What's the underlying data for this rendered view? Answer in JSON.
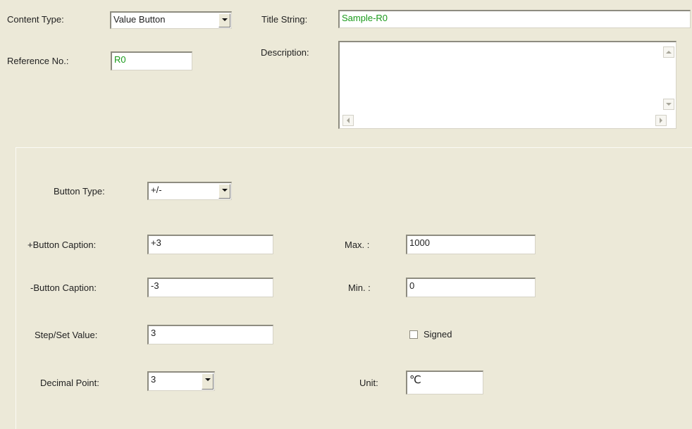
{
  "top": {
    "content_type_label": "Content Type:",
    "content_type_value": "Value Button",
    "title_string_label": "Title String:",
    "title_string_value": "Sample-R0",
    "reference_no_label": "Reference No.:",
    "reference_no_value": "R0",
    "description_label": "Description:",
    "description_value": ""
  },
  "panel": {
    "button_type_label": "Button Type:",
    "button_type_value": "+/-",
    "plus_caption_label": "+Button Caption:",
    "plus_caption_value": "+3",
    "minus_caption_label": "-Button Caption:",
    "minus_caption_value": "-3",
    "step_label": "Step/Set Value:",
    "step_value": "3",
    "decimal_label": "Decimal Point:",
    "decimal_value": "3",
    "max_label": "Max. :",
    "max_value": "1000",
    "min_label": "Min. :",
    "min_value": "0",
    "signed_label": "Signed",
    "signed_checked": false,
    "unit_label": "Unit:",
    "unit_value": "℃"
  }
}
